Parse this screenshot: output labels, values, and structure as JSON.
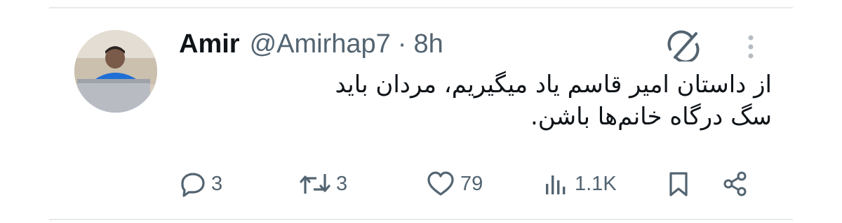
{
  "tweet": {
    "author_name": "Amir",
    "handle": "@Amirhap7",
    "separator": "·",
    "time": "8h",
    "text_line1": "از داستان امیر قاسم یاد میگیریم، مردان باید",
    "text_line2": "سگ درگاه خانم‌ها باشن."
  },
  "actions": {
    "replies": "3",
    "retweets": "3",
    "likes": "79",
    "views": "1.1K"
  },
  "icons": [
    "grok-icon",
    "more-icon",
    "reply-icon",
    "retweet-icon",
    "like-icon",
    "views-icon",
    "bookmark-icon",
    "share-icon"
  ],
  "colors": {
    "text": "#0f1419",
    "secondary": "#536471",
    "divider": "#e7e9ea"
  }
}
